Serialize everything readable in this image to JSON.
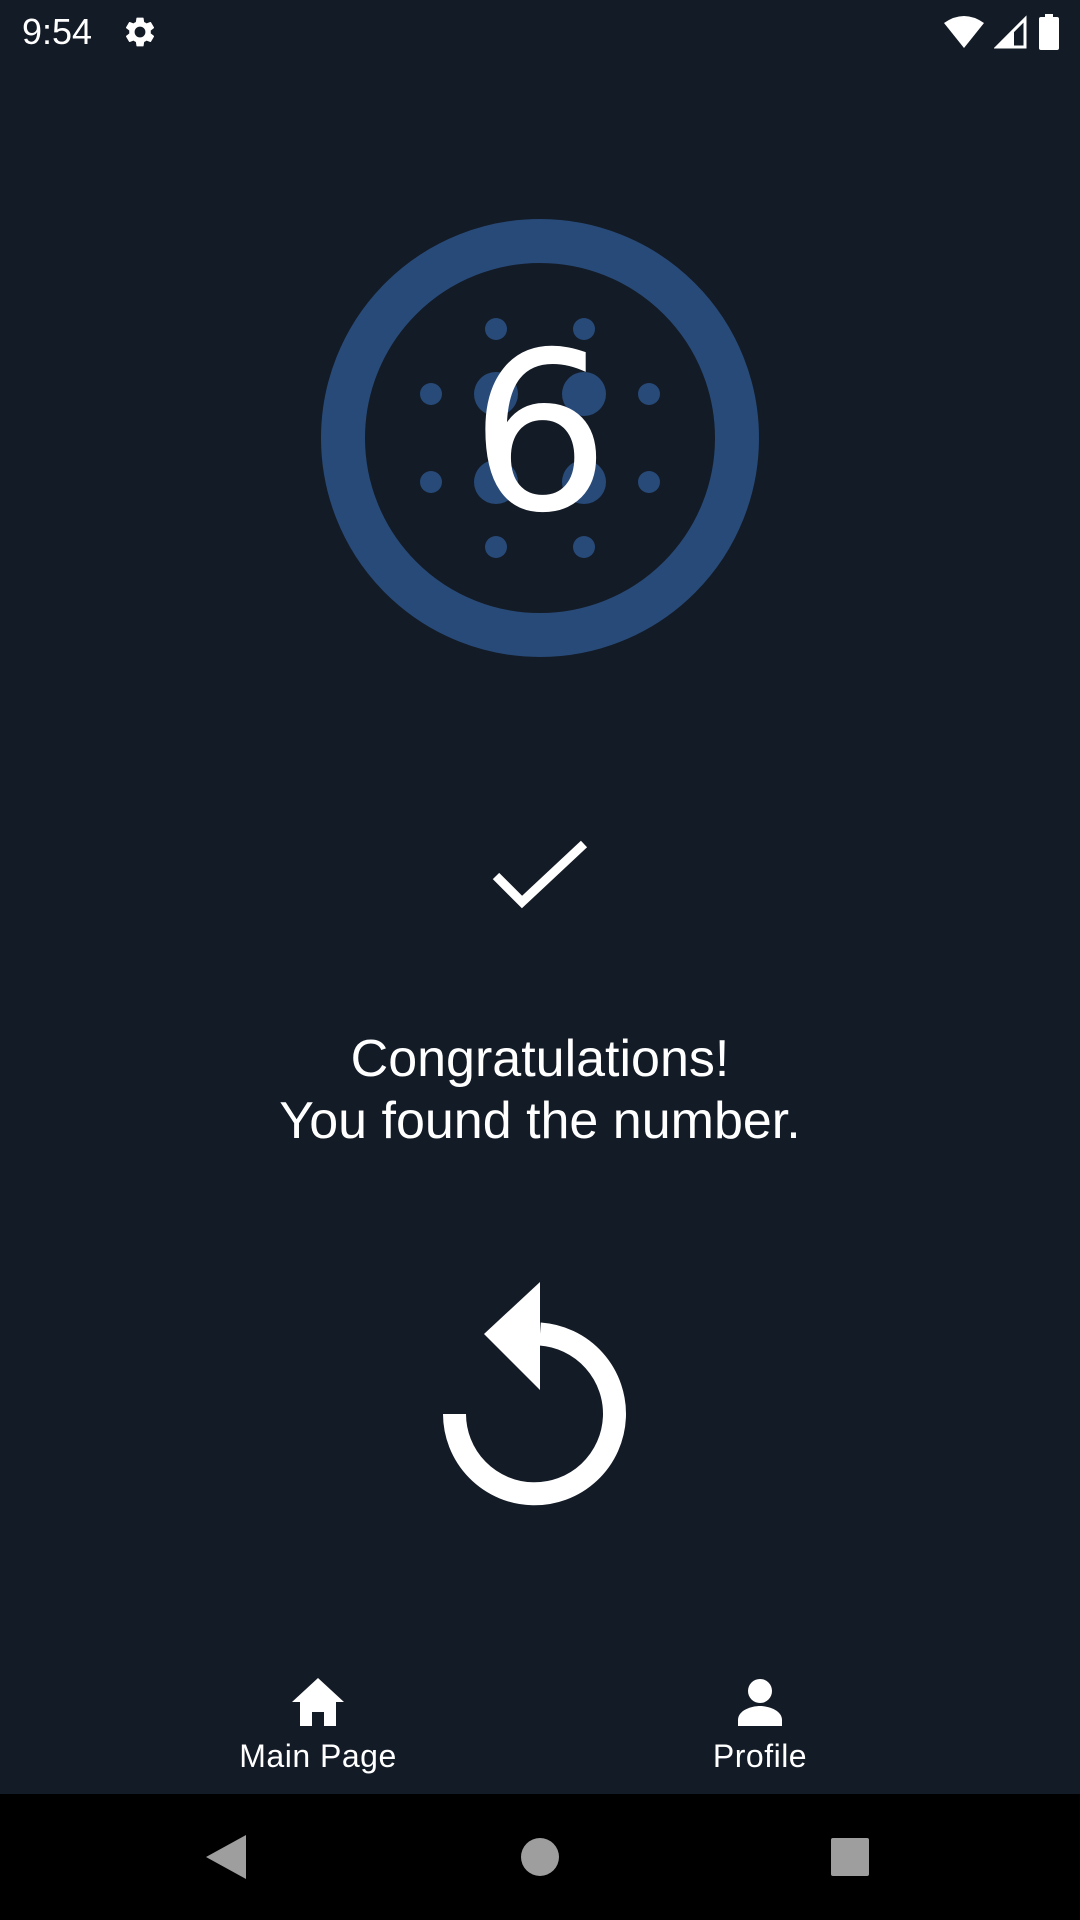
{
  "status_bar": {
    "time": "9:54",
    "icons": [
      "gear-icon",
      "wifi-icon",
      "signal-icon",
      "battery-icon"
    ]
  },
  "game": {
    "found_number": "6",
    "ring_color": "#284a78",
    "message_line1": "Congratulations!",
    "message_line2": "You found the number."
  },
  "bottom_nav": {
    "items": [
      {
        "label": "Main Page",
        "icon": "home-icon"
      },
      {
        "label": "Profile",
        "icon": "person-icon"
      }
    ]
  },
  "colors": {
    "background": "#131b26",
    "accent": "#284a78",
    "text": "#ffffff"
  }
}
